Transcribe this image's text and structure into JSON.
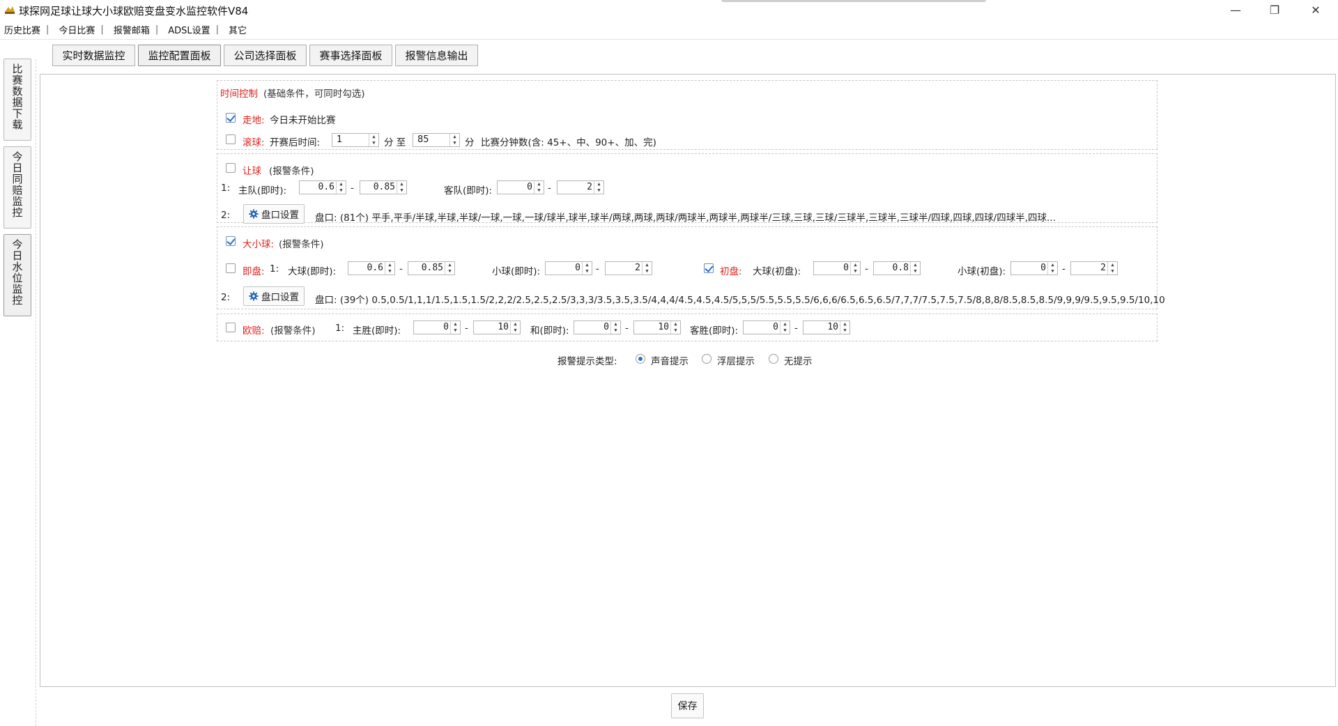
{
  "window": {
    "title": "球探网足球让球大小球欧赔变盘变水监控软件V84",
    "minimize": "—",
    "maximize": "❐",
    "close": "✕"
  },
  "menu": {
    "items": [
      "历史比赛",
      "今日比赛",
      "报警邮箱",
      "ADSL设置",
      "其它"
    ],
    "separator": "|"
  },
  "side_tabs": [
    {
      "label": "比赛数据下载"
    },
    {
      "label": "今日同赔监控"
    },
    {
      "label": "今日水位监控"
    }
  ],
  "top_tabs": [
    {
      "label": "实时数据监控"
    },
    {
      "label": "监控配置面板"
    },
    {
      "label": "公司选择面板"
    },
    {
      "label": "赛事选择面板"
    },
    {
      "label": "报警信息输出"
    }
  ],
  "time_control": {
    "title": "时间控制",
    "subtitle": "(基础条件，可同时勾选)",
    "walk_label": "走地:",
    "walk_desc": "今日未开始比赛",
    "walk_checked": true,
    "rolling_label": "滚球:",
    "rolling_checked": false,
    "after_start": "开赛后时间:",
    "from_value": "1",
    "minute1": "分 至",
    "to_value": "85",
    "minute2": "分",
    "minutes_desc": "比赛分钟数(含: 45+、中、90+、加、完)"
  },
  "handicap": {
    "title": "让球",
    "subtitle": "(报警条件)",
    "checked": false,
    "row1_index": "1:",
    "home_label": "主队(即时):",
    "home_min": "0.6",
    "home_max": "0.85",
    "away_label": "客队(即时):",
    "away_min": "0",
    "away_max": "2",
    "dash": "-",
    "row2_index": "2:",
    "cfg_button": "盘口设置",
    "lines": "盘口: (81个) 平手,平手/半球,半球,半球/一球,一球,一球/球半,球半,球半/两球,两球,两球/两球半,两球半,两球半/三球,三球,三球/三球半,三球半,三球半/四球,四球,四球/四球半,四球..."
  },
  "overunder": {
    "title": "大小球:",
    "subtitle": "(报警条件)",
    "checked": true,
    "live_label": "即盘:",
    "live_checked": false,
    "row1_index": "1:",
    "big_live_label": "大球(即时):",
    "big_live_min": "0.6",
    "big_live_max": "0.85",
    "small_live_label": "小球(即时):",
    "small_live_min": "0",
    "small_live_max": "2",
    "init_label": "初盘:",
    "init_checked": true,
    "big_init_label": "大球(初盘):",
    "big_init_min": "0",
    "big_init_max": "0.8",
    "small_init_label": "小球(初盘):",
    "small_init_min": "0",
    "small_init_max": "2",
    "row2_index": "2:",
    "cfg_button": "盘口设置",
    "lines": "盘口: (39个) 0.5,0.5/1,1,1/1.5,1.5,1.5/2,2,2/2.5,2.5,2.5/3,3,3/3.5,3.5,3.5/4,4,4/4.5,4.5,4.5/5,5,5/5.5,5.5,5.5/6,6,6/6.5,6.5,6.5/7,7,7/7.5,7.5,7.5/8,8,8/8.5,8.5,8.5/9,9,9/9.5,9.5,9.5/10,10"
  },
  "european": {
    "title": "欧赔:",
    "subtitle": "(报警条件)",
    "checked": false,
    "row1_index": "1:",
    "home_label": "主胜(即时):",
    "home_min": "0",
    "home_max": "10",
    "draw_label": "和(即时):",
    "draw_min": "0",
    "draw_max": "10",
    "away_label": "客胜(即时):",
    "away_min": "0",
    "away_max": "10"
  },
  "alert": {
    "label": "报警提示类型:",
    "options": [
      "声音提示",
      "浮层提示",
      "无提示"
    ],
    "selected": "声音提示"
  },
  "save_button": "保存"
}
